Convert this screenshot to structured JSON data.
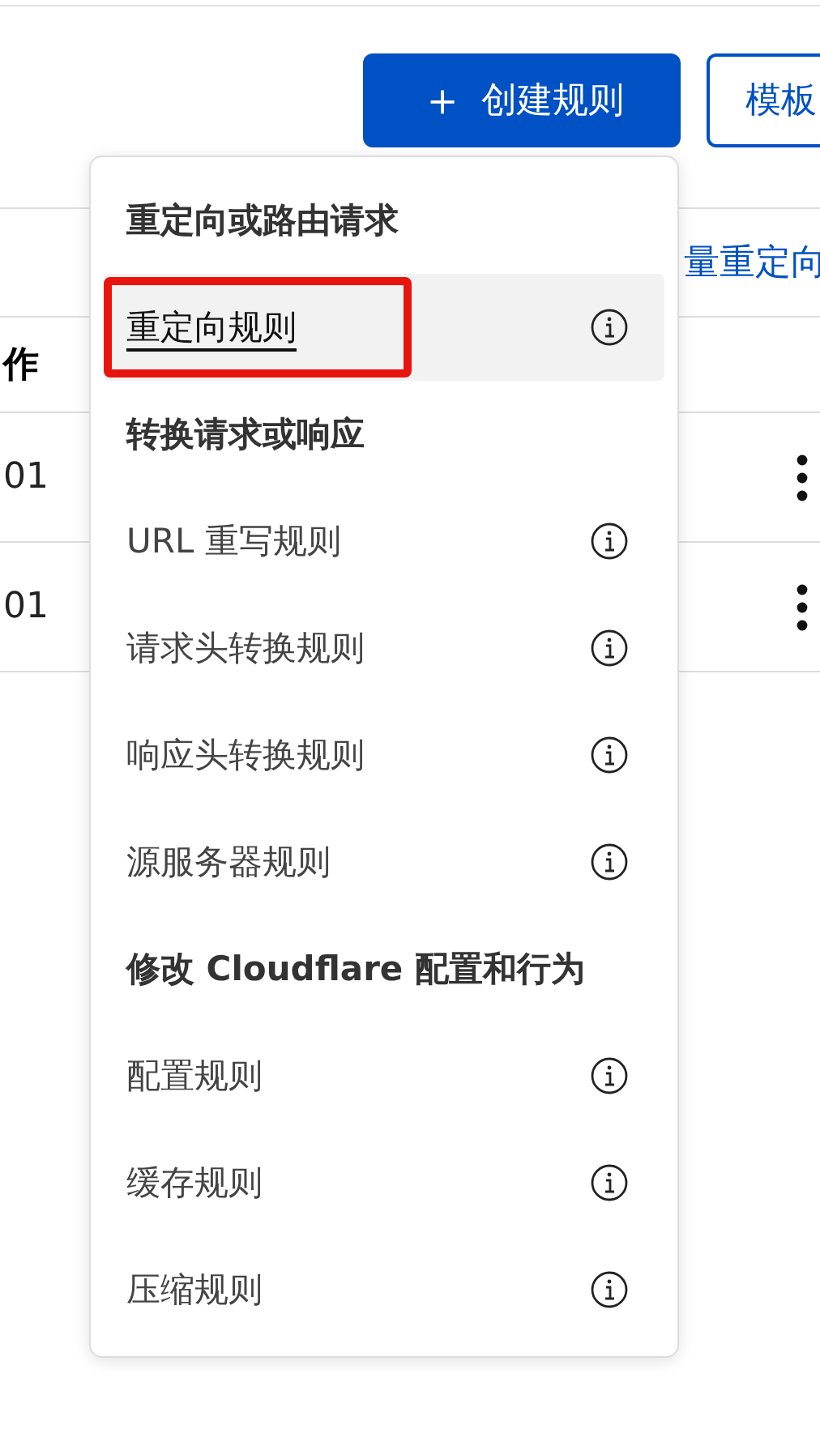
{
  "toolbar": {
    "create_button": {
      "icon": "＋",
      "label": "创建规则"
    },
    "template_button": {
      "label": "模板"
    }
  },
  "table": {
    "link": "量重定向",
    "columns": [
      "作"
    ],
    "rows": [
      {
        "cell": "01"
      },
      {
        "cell": "01"
      }
    ]
  },
  "menu": {
    "groups": [
      {
        "heading": "重定向或路由请求",
        "items": [
          {
            "label": "重定向规则",
            "selected": true
          }
        ]
      },
      {
        "heading": "转换请求或响应",
        "items": [
          {
            "label": "URL 重写规则",
            "selected": false
          },
          {
            "label": "请求头转换规则",
            "selected": false
          },
          {
            "label": "响应头转换规则",
            "selected": false
          },
          {
            "label": "源服务器规则",
            "selected": false
          }
        ]
      },
      {
        "heading": "修改 Cloudflare 配置和行为",
        "items": [
          {
            "label": "配置规则",
            "selected": false
          },
          {
            "label": "缓存规则",
            "selected": false
          },
          {
            "label": "压缩规则",
            "selected": false
          }
        ]
      }
    ]
  }
}
